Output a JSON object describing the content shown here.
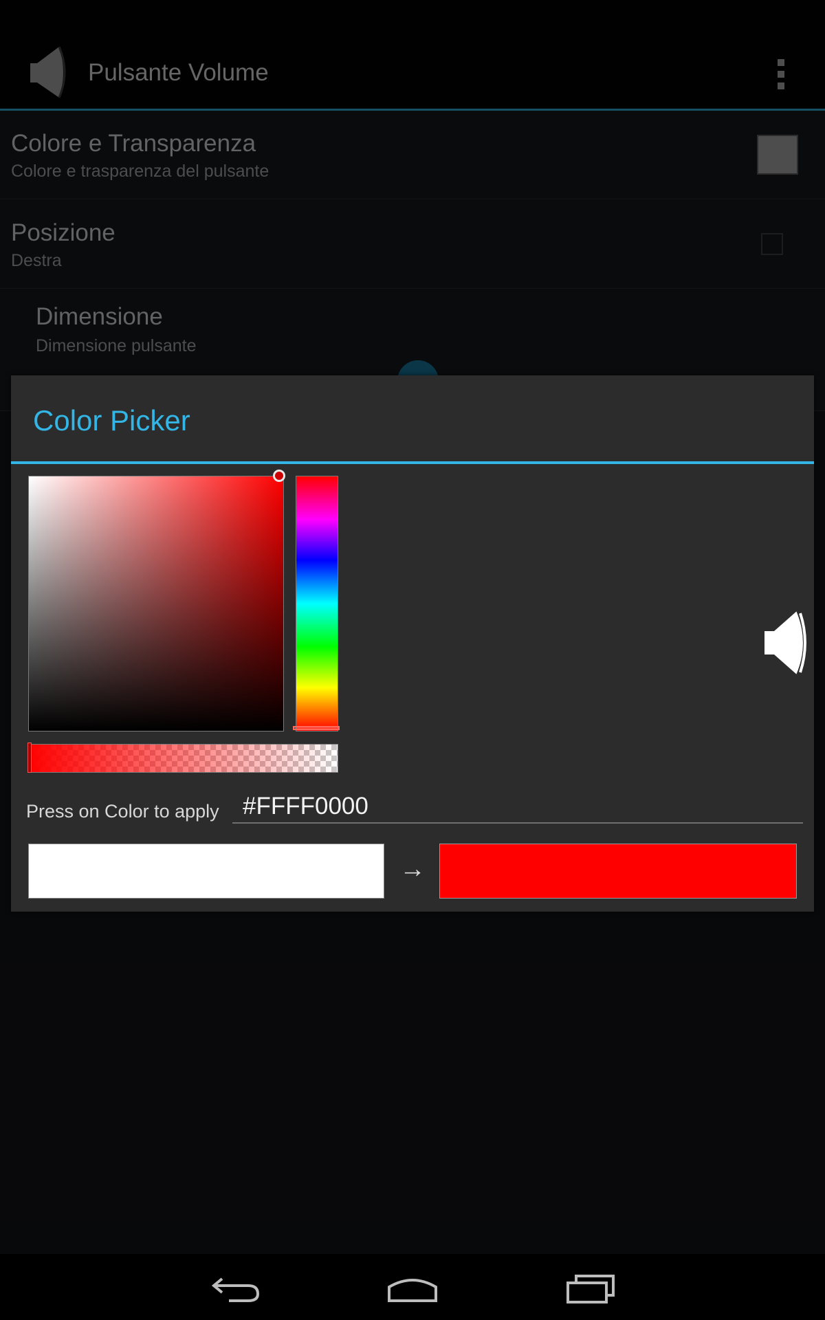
{
  "action_bar": {
    "title": "Pulsante Volume",
    "app_icon": "speaker-icon",
    "overflow_icon": "more-vert-icon"
  },
  "preferences": [
    {
      "title": "Colore e Transparenza",
      "summary": "Colore e trasparenza del pulsante",
      "widget": "color-swatch"
    },
    {
      "title": "Posizione",
      "summary": "Destra",
      "widget": "checkbox"
    },
    {
      "title": "Dimensione",
      "summary": "Dimensione pulsante",
      "widget": "slider"
    }
  ],
  "dialog": {
    "title": "Color Picker",
    "apply_label": "Press on Color to apply",
    "hex_value": "#FFFF0000",
    "arrow": "→",
    "old_color": "#FFFFFF",
    "new_color": "#FF0000",
    "hue": "red",
    "alpha": 1.0,
    "preview_icon": "speaker-icon"
  },
  "colors": {
    "accent": "#33b5e5",
    "dialog_bg": "#2c2c2d",
    "swatch": "#6b6b6b"
  },
  "nav_bar": {
    "back_icon": "back-icon",
    "home_icon": "home-icon",
    "recents_icon": "recents-icon"
  }
}
